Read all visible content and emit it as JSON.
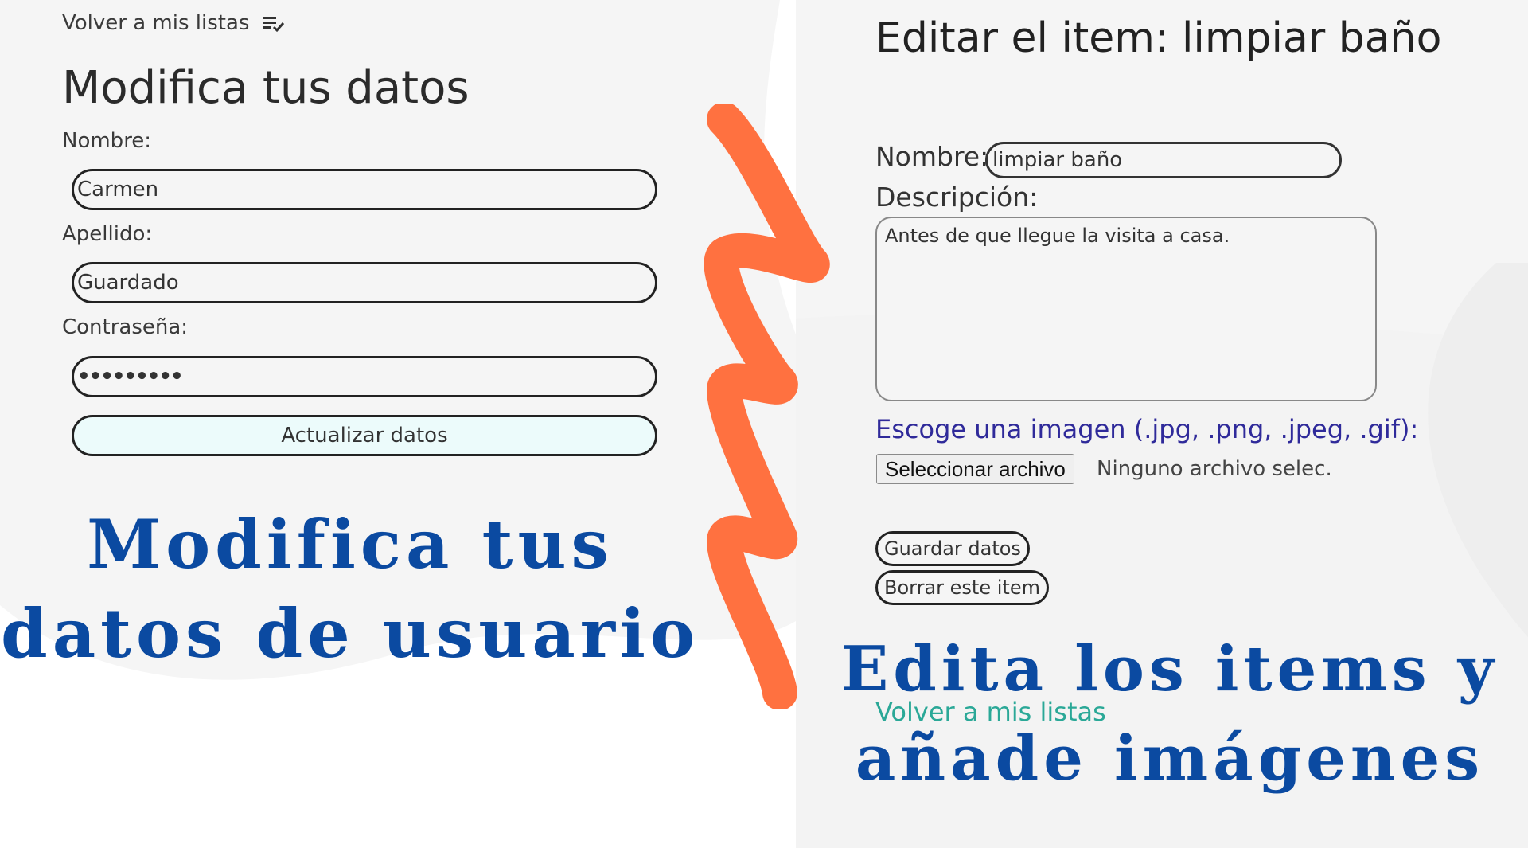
{
  "left": {
    "back_link": "Volver a mis listas",
    "heading": "Modifica tus datos",
    "fields": [
      {
        "label": "Nombre:",
        "value": "Carmen"
      },
      {
        "label": "Apellido:",
        "value": "Guardado"
      },
      {
        "label": "Contraseña:",
        "value": "•••••••••"
      }
    ],
    "submit_label": "Actualizar datos",
    "promo_line1": "Modifica tus",
    "promo_line2": "datos de usuario"
  },
  "right": {
    "heading": "Editar el item: limpiar baño",
    "name_label": "Nombre:",
    "name_value": "limpiar baño",
    "description_label": "Descripción:",
    "description_value": "Antes de que llegue la visita a casa.",
    "image_label": "Escoge una imagen (.jpg, .png, .jpeg, .gif):",
    "file_button": "Seleccionar archivo",
    "file_status": "Ninguno archivo selec.",
    "save_button": "Guardar datos",
    "delete_button": "Borrar este item",
    "back_link": "Volver a mis listas",
    "promo_line1": "Edita los items y",
    "promo_line2": "añade imágenes"
  },
  "colors": {
    "promo_blue": "#0b4aa1",
    "zigzag_orange": "#ff7140",
    "teal_link": "#2aa897",
    "label_purple": "#2f2a9a"
  },
  "icons": [
    "playlist-check-icon"
  ]
}
